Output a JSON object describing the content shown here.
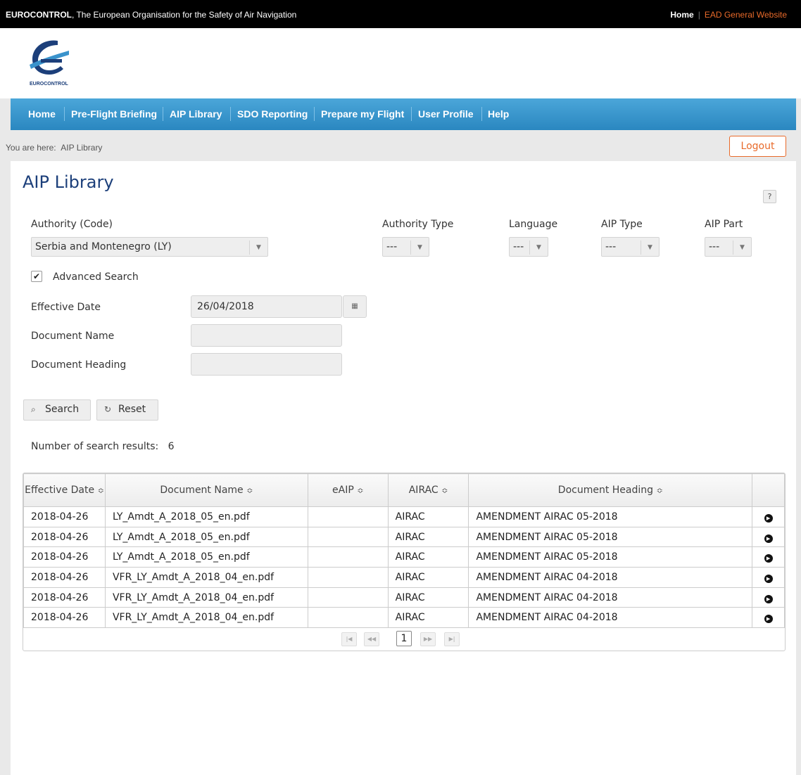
{
  "topbar": {
    "org_bold": "EUROCONTROL",
    "org_rest": ", The European Organisation for the Safety of Air Navigation",
    "home_link": "Home",
    "separator": "|",
    "ead_link": "EAD General Website"
  },
  "logo": {
    "text": "EUROCONTROL"
  },
  "nav": {
    "items": [
      "Home",
      "Pre-Flight Briefing",
      "AIP Library",
      "SDO Reporting",
      "Prepare my Flight",
      "User Profile",
      "Help"
    ]
  },
  "breadcrumb": {
    "prefix": "You are here:",
    "current": "AIP Library"
  },
  "logout_label": "Logout",
  "page": {
    "title": "AIP Library",
    "help": "?"
  },
  "filters": {
    "authority_label": "Authority (Code)",
    "authority_value": "Serbia and Montenegro (LY)",
    "authority_type_label": "Authority Type",
    "authority_type_value": "---",
    "language_label": "Language",
    "language_value": "---",
    "aip_type_label": "AIP Type",
    "aip_type_value": "---",
    "aip_part_label": "AIP Part",
    "aip_part_value": "---",
    "advanced_search_label": "Advanced Search",
    "advanced_search_checked": "✔",
    "effective_date_label": "Effective Date",
    "effective_date_value": "26/04/2018",
    "document_name_label": "Document Name",
    "document_name_value": "",
    "document_heading_label": "Document Heading",
    "document_heading_value": ""
  },
  "actions": {
    "search_label": "Search",
    "reset_label": "Reset"
  },
  "results": {
    "count_label": "Number of search results:",
    "count": "6",
    "columns": [
      "Effective Date",
      "Document Name",
      "eAIP",
      "AIRAC",
      "Document Heading",
      ""
    ],
    "sort_glyph": "≎",
    "rows": [
      {
        "date": "2018-04-26",
        "name": "LY_Amdt_A_2018_05_en.pdf",
        "eaip": "",
        "airac": "AIRAC",
        "heading": "AMENDMENT AIRAC 05-2018"
      },
      {
        "date": "2018-04-26",
        "name": "LY_Amdt_A_2018_05_en.pdf",
        "eaip": "",
        "airac": "AIRAC",
        "heading": "AMENDMENT AIRAC 05-2018"
      },
      {
        "date": "2018-04-26",
        "name": "LY_Amdt_A_2018_05_en.pdf",
        "eaip": "",
        "airac": "AIRAC",
        "heading": "AMENDMENT AIRAC 05-2018"
      },
      {
        "date": "2018-04-26",
        "name": "VFR_LY_Amdt_A_2018_04_en.pdf",
        "eaip": "",
        "airac": "AIRAC",
        "heading": "AMENDMENT AIRAC 04-2018"
      },
      {
        "date": "2018-04-26",
        "name": "VFR_LY_Amdt_A_2018_04_en.pdf",
        "eaip": "",
        "airac": "AIRAC",
        "heading": "AMENDMENT AIRAC 04-2018"
      },
      {
        "date": "2018-04-26",
        "name": "VFR_LY_Amdt_A_2018_04_en.pdf",
        "eaip": "",
        "airac": "AIRAC",
        "heading": "AMENDMENT AIRAC 04-2018"
      }
    ]
  },
  "pager": {
    "current_page": "1"
  },
  "icons": {
    "dropdown": "chevron-down-icon",
    "calendar": "calendar-icon",
    "search": "search-icon",
    "reset": "reset-icon",
    "row_action": "play-circle-icon",
    "pager_first": "first-page-icon",
    "pager_prev": "prev-page-icon",
    "pager_next": "next-page-icon",
    "pager_last": "last-page-icon"
  },
  "colors": {
    "brand_blue": "#1c3f7a",
    "nav_blue": "#2a87c0",
    "accent_orange": "#e86a2a"
  }
}
